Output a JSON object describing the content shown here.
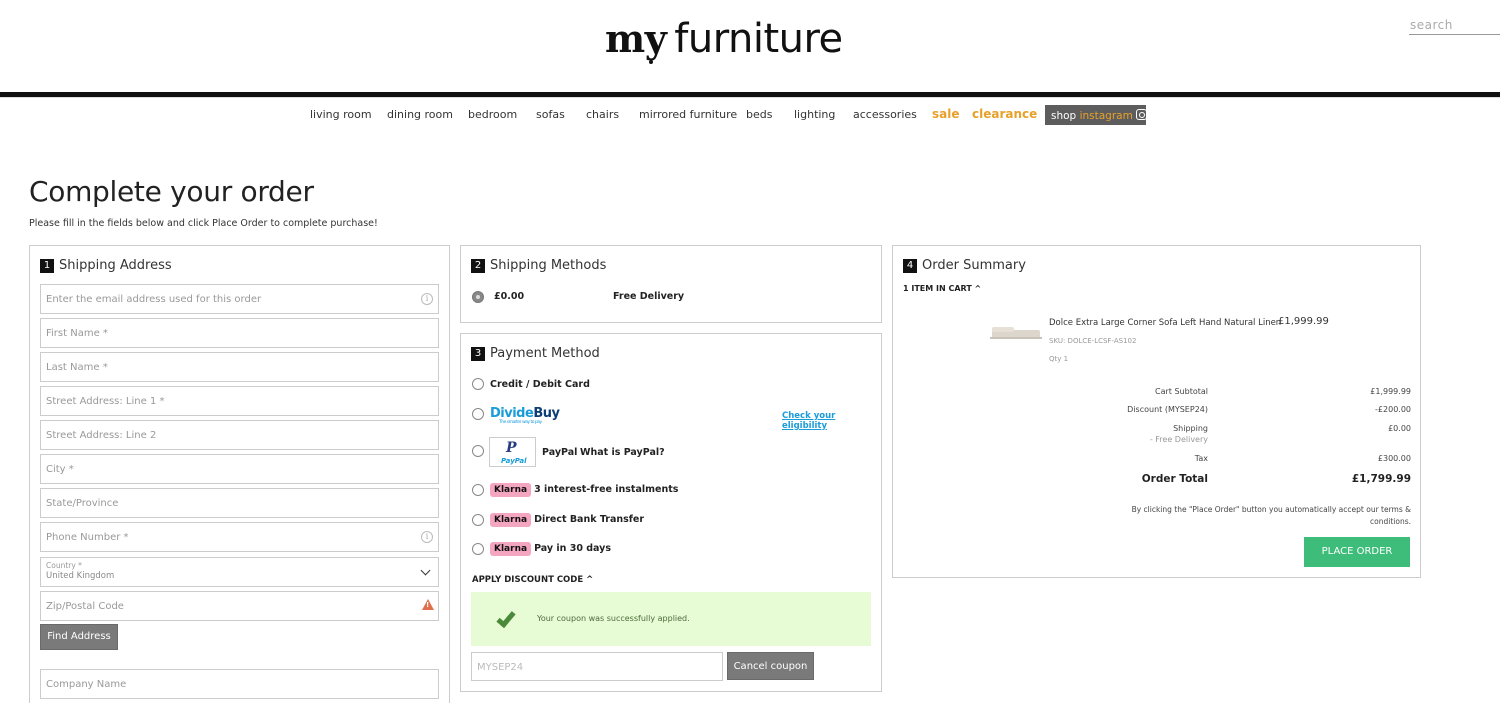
{
  "header": {
    "logo_my": "my",
    "logo_furniture": "furniture",
    "search_placeholder": "search"
  },
  "nav": {
    "items": [
      "living room",
      "dining room",
      "bedroom",
      "sofas",
      "chairs",
      "mirrored furniture",
      "beds",
      "lighting",
      "accessories"
    ],
    "sale": "sale",
    "clearance": "clearance",
    "instagram_prefix": "shop",
    "instagram_word": "instagram"
  },
  "page": {
    "title": "Complete your order",
    "subtitle": "Please fill in the fields below and click Place Order to complete purchase!"
  },
  "shipping_address": {
    "num": "1",
    "heading": "Shipping Address",
    "email_placeholder": "Enter the email address used for this order",
    "first_name": "First Name *",
    "last_name": "Last Name *",
    "street1": "Street Address: Line 1 *",
    "street2": "Street Address: Line 2",
    "city": "City *",
    "state": "State/Province",
    "phone": "Phone Number *",
    "country_label": "Country *",
    "country_value": "United Kingdom",
    "zip": "Zip/Postal Code",
    "find_address": "Find Address",
    "company": "Company Name"
  },
  "shipping_methods": {
    "num": "2",
    "heading": "Shipping Methods",
    "price": "£0.00",
    "method": "Free Delivery"
  },
  "payment": {
    "num": "3",
    "heading": "Payment Method",
    "card": "Credit / Debit Card",
    "dividebuy_divide": "Divide",
    "dividebuy_buy": "Buy",
    "dividebuy_tag": "The smarter way to pay",
    "check_eligibility": "Check your eligibility",
    "paypal_p": "P",
    "paypal_logo_text": "PayPal",
    "paypal_label": "PayPal",
    "paypal_what": "What is PayPal?",
    "klarna_badge": "Klarna",
    "klarna_1": "3 interest-free instalments",
    "klarna_2": "Direct Bank Transfer",
    "klarna_3": "Pay in 30 days",
    "discount_toggle": "APPLY DISCOUNT CODE ^",
    "coupon_success": "Your coupon was successfully applied.",
    "coupon_code": "MYSEP24",
    "cancel_coupon": "Cancel coupon"
  },
  "summary": {
    "num": "4",
    "heading": "Order Summary",
    "items_in_cart": "1 ITEM IN CART ^",
    "product_name": "Dolce Extra Large Corner Sofa Left Hand Natural Linen",
    "product_price": "£1,999.99",
    "sku": "SKU: DOLCE-LCSF-AS102",
    "qty": "Qty 1",
    "cart_subtotal_label": "Cart Subtotal",
    "cart_subtotal": "£1,999.99",
    "discount_label": "Discount (MYSEP24)",
    "discount": "-£200.00",
    "shipping_label": "Shipping",
    "shipping_sub": "- Free Delivery",
    "shipping": "£0.00",
    "tax_label": "Tax",
    "tax": "£300.00",
    "order_total_label": "Order Total",
    "order_total": "£1,799.99",
    "terms": "By clicking the \"Place Order\" button you automatically accept our terms & conditions.",
    "place_order": "PLACE ORDER"
  }
}
